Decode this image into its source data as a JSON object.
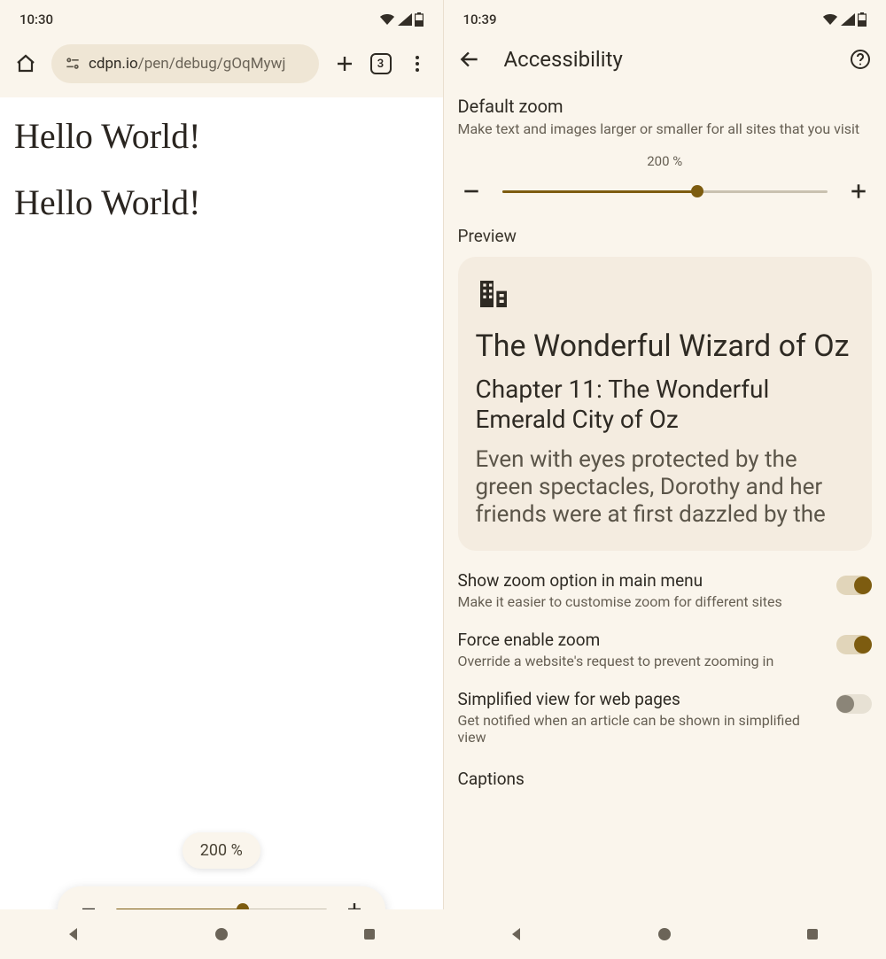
{
  "left": {
    "status": {
      "time": "10:30"
    },
    "browser": {
      "url_domain": "cdpn.io",
      "url_path": "/pen/debug/gOqMywj",
      "tab_count": "3"
    },
    "content": {
      "line1": "Hello World!",
      "line2": "Hello World!"
    },
    "zoom": {
      "bubble": "200 %",
      "percent": 60
    }
  },
  "right": {
    "status": {
      "time": "10:39"
    },
    "header": {
      "title": "Accessibility"
    },
    "default_zoom": {
      "title": "Default zoom",
      "sub": "Make text and images larger or smaller for all sites that you visit",
      "value": "200 %",
      "percent": 60
    },
    "preview": {
      "label": "Preview",
      "heading": "The Wonderful Wizard of Oz",
      "chapter": "Chapter 11: The Wonderful Emerald City of Oz",
      "body": "Even with eyes protected by the green spectacles, Dorothy and her friends were at first dazzled by the"
    },
    "settings": [
      {
        "title": "Show zoom option in main menu",
        "sub": "Make it easier to customise zoom for different sites",
        "on": true
      },
      {
        "title": "Force enable zoom",
        "sub": "Override a website's request to prevent zooming in",
        "on": true
      },
      {
        "title": "Simplified view for web pages",
        "sub": "Get notified when an article can be shown in simplified view",
        "on": false
      }
    ],
    "captions": "Captions"
  },
  "colors": {
    "accent": "#7d5c10"
  }
}
